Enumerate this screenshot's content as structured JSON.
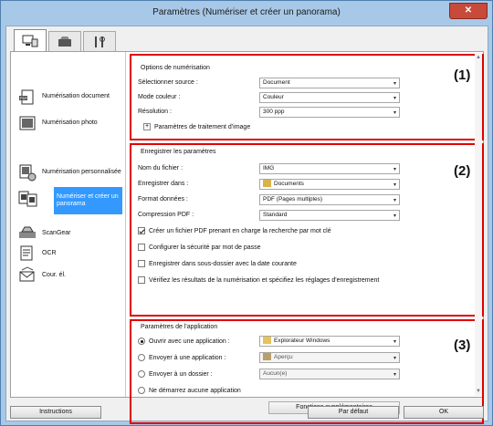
{
  "window": {
    "title": "Paramètres (Numériser et créer un panorama)",
    "close_label": "✕"
  },
  "tabs": [
    {
      "icon": "scan-from-computer-icon"
    },
    {
      "icon": "scan-from-operation-panel-icon"
    },
    {
      "icon": "general-settings-icon"
    }
  ],
  "sidebar": {
    "items": [
      {
        "label": "Numérisation document",
        "icon": "document-scan-icon"
      },
      {
        "label": "Numérisation photo",
        "icon": "photo-scan-icon"
      },
      {
        "label": "Numérisation personnalisée",
        "icon": "custom-scan-icon"
      },
      {
        "label": "Numériser et créer un panorama",
        "icon": "stitch-icon",
        "selected": true
      },
      {
        "label": "ScanGear",
        "icon": "scangear-icon"
      },
      {
        "label": "OCR",
        "icon": "ocr-icon"
      },
      {
        "label": "Cour. él.",
        "icon": "email-icon"
      }
    ]
  },
  "section1": {
    "number": "(1)",
    "group_title": "Options de numérisation",
    "fields": [
      {
        "label": "Sélectionner source :",
        "value": "Document"
      },
      {
        "label": "Mode couleur :",
        "value": "Couleur"
      },
      {
        "label": "Résolution :",
        "value": "300 ppp"
      }
    ],
    "expander_label": "Paramètres de traitement d'image"
  },
  "section2": {
    "number": "(2)",
    "group_title": "Enregistrer les paramètres",
    "fields": [
      {
        "label": "Nom du fichier :",
        "value": "IMG"
      },
      {
        "label": "Enregistrer dans :",
        "value": "Documents"
      },
      {
        "label": "Format données :",
        "value": "PDF (Pages multiples)"
      },
      {
        "label": "Compression PDF :",
        "value": "Standard"
      }
    ],
    "checkboxes": [
      {
        "label": "Créer un fichier PDF prenant en charge la recherche par mot clé",
        "checked": true
      },
      {
        "label": "Configurer la sécurité par mot de passe",
        "checked": false
      },
      {
        "label": "Enregistrer dans sous-dossier avec la date courante",
        "checked": false
      },
      {
        "label": "Vérifiez les résultats de la numérisation et spécifiez les réglages d'enregistrement",
        "checked": false
      }
    ]
  },
  "section3": {
    "number": "(3)",
    "group_title": "Paramètres de l'application",
    "radios": [
      {
        "label": "Ouvrir avec une application :",
        "value": "Explorateur Windows",
        "on": true,
        "disabled": false
      },
      {
        "label": "Envoyer à une application :",
        "value": "Aperçu",
        "on": false,
        "disabled": true
      },
      {
        "label": "Envoyer à un dossier :",
        "value": "Aucun(e)",
        "on": false,
        "disabled": true
      },
      {
        "label": "Ne démarrez aucune application",
        "on": false
      }
    ],
    "more_button": "Fonctions supplémentaires"
  },
  "footer": {
    "instructions": "Instructions",
    "default": "Par défaut",
    "ok": "OK"
  },
  "colors": {
    "highlight": "#e00000",
    "selected": "#3399ff"
  }
}
